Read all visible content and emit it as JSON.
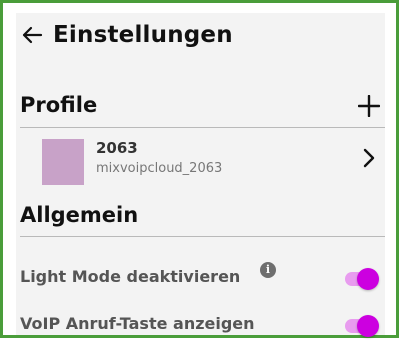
{
  "header": {
    "title": "Einstellungen",
    "back_icon": "arrow-left-icon"
  },
  "profiles": {
    "section_title": "Profile",
    "add_icon": "plus-icon",
    "items": [
      {
        "name": "2063",
        "account": "mixvoipcloud_2063",
        "avatar_color": "#c8a2c8",
        "chevron_icon": "chevron-right-icon"
      }
    ]
  },
  "general": {
    "section_title": "Allgemein",
    "settings": [
      {
        "label": "Light Mode deaktivieren",
        "has_info": true,
        "info_icon": "info-icon",
        "enabled": true
      },
      {
        "label": "VoIP Anruf-Taste anzeigen",
        "has_info": false,
        "enabled": true
      }
    ]
  },
  "colors": {
    "accent": "#cc00e0",
    "accent_track": "#e89cef",
    "frame": "#4a9d3a",
    "background": "#f3f3f3"
  }
}
